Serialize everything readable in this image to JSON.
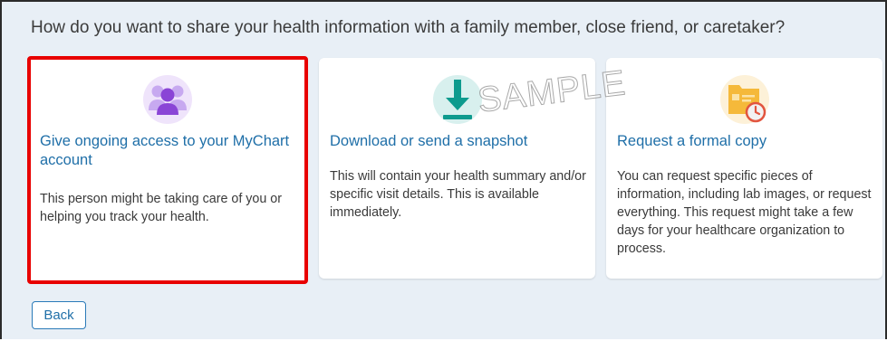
{
  "prompt": {
    "question": "How do you want to share your health information with a family member, close friend, or caretaker?"
  },
  "options": [
    {
      "icon": "people-group-icon",
      "title": "Give ongoing access to your MyChart account",
      "description": "This person might be taking care of you or helping you track your health.",
      "selected": true
    },
    {
      "icon": "download-icon",
      "title": "Download or send a snapshot",
      "description": "This will contain your health summary and/or specific visit details. This is available immediately."
    },
    {
      "icon": "document-clock-icon",
      "title": "Request a formal copy",
      "description": "You can request specific pieces of information, including lab images, or request everything. This request might take a few days for your healthcare organization to process."
    }
  ],
  "watermark": "SAMPLE",
  "actions": {
    "back_label": "Back"
  },
  "colors": {
    "background": "#e8eff6",
    "link": "#1f6fa8",
    "selection_outline": "#e80000"
  }
}
